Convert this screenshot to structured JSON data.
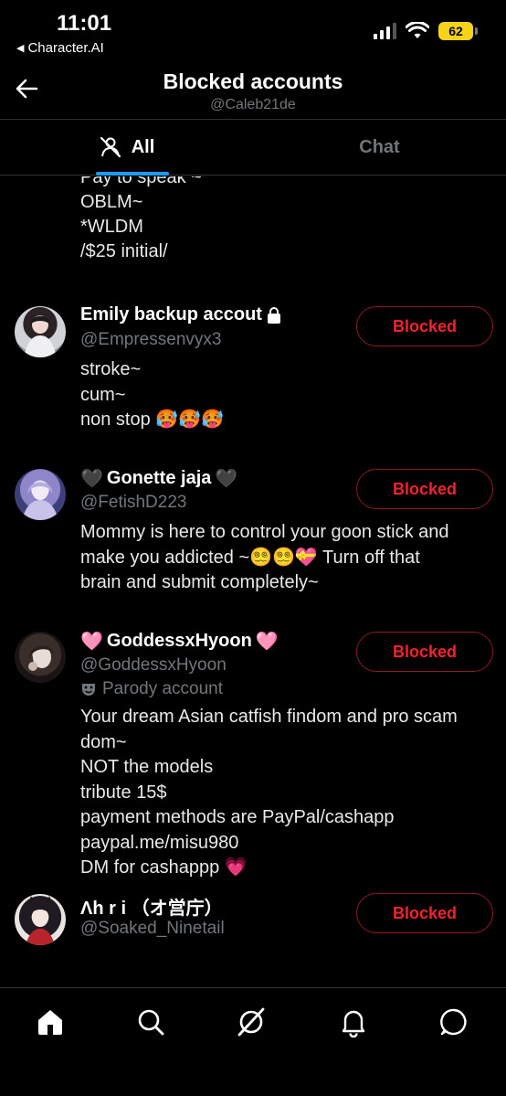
{
  "status_bar": {
    "time": "11:01",
    "back_app": "Character.AI",
    "battery": "62",
    "battery_color": "#f7d21a"
  },
  "header": {
    "title": "Blocked accounts",
    "subtitle": "@Caleb21de"
  },
  "tabs": [
    {
      "label": "All",
      "icon": "person-slash-icon",
      "active": true
    },
    {
      "label": "Chat",
      "active": false
    }
  ],
  "partial_bio": [
    "Pay to speak ~",
    "OBLM~",
    "*WLDM",
    "/$25 initial/"
  ],
  "accounts": [
    {
      "name": "Emily backup accout",
      "locked": true,
      "handle": "@Empressenvyx3",
      "bio": [
        "stroke~",
        "cum~",
        "non stop 🥵🥵🥵"
      ],
      "button": "Blocked"
    },
    {
      "name": "Gonette jaja",
      "name_prefix": "🖤",
      "name_suffix": "🖤",
      "handle": "@FetishD223",
      "bio": [
        "Mommy is here to control your goon stick and",
        "make you addicted ~😵‍💫😵‍💫💝 Turn off that",
        "brain and submit completely~"
      ],
      "button": "Blocked"
    },
    {
      "name": "GoddessxHyoon",
      "name_prefix": "🩷",
      "name_suffix": "🩷",
      "handle": "@GoddessxHyoon",
      "parody": "Parody account",
      "bio": [
        "Your dream Asian catfish findom and pro scam",
        "dom~",
        "NOT the models",
        "tribute 15$",
        "payment methods are PayPal/cashapp",
        "paypal.me/misu980",
        "DM for cashappp 💗"
      ],
      "button": "Blocked"
    },
    {
      "name": "Λh r i （オ営庁）",
      "handle": "@Soaked_Ninetail",
      "button": "Blocked"
    }
  ],
  "bottom_nav": [
    "home-icon",
    "search-icon",
    "grok-icon",
    "notifications-icon",
    "messages-icon"
  ],
  "colors": {
    "accent": "#1d9bf0",
    "blocked_red": "#f4212e",
    "muted": "#71767b"
  }
}
